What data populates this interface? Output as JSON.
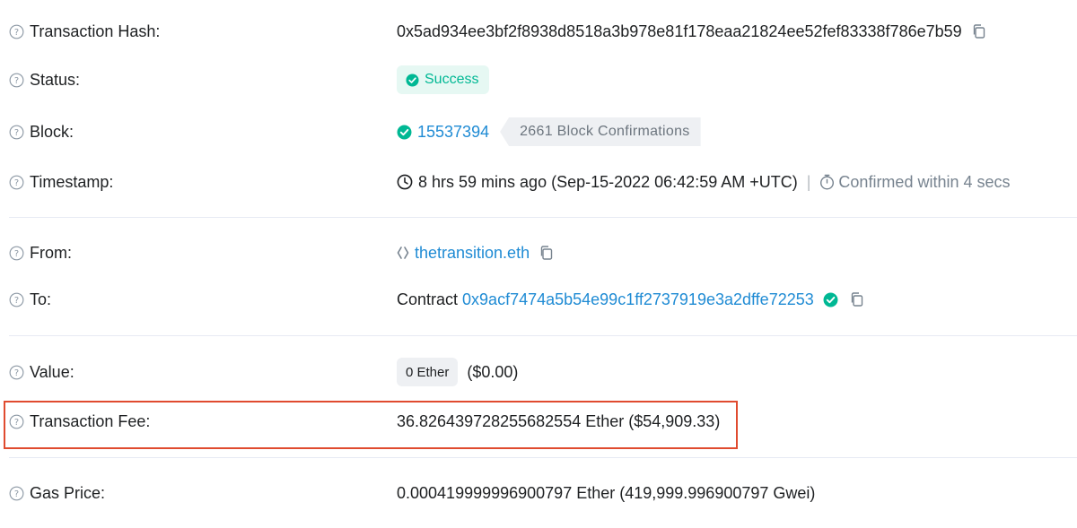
{
  "rows": {
    "tx_hash": {
      "label": "Transaction Hash:",
      "value": "0x5ad934ee3bf2f8938d8518a3b978e81f178eaa21824ee52fef83338f786e7b59"
    },
    "status": {
      "label": "Status:",
      "value": "Success"
    },
    "block": {
      "label": "Block:",
      "number": "15537394",
      "confirmations": "2661 Block Confirmations"
    },
    "timestamp": {
      "label": "Timestamp:",
      "value": "8 hrs 59 mins ago (Sep-15-2022 06:42:59 AM +UTC)",
      "separator": "|",
      "confirmed": "Confirmed within 4 secs"
    },
    "from": {
      "label": "From:",
      "value": "thetransition.eth"
    },
    "to": {
      "label": "To:",
      "prefix": "Contract",
      "address": "0x9acf7474a5b54e99c1ff2737919e3a2dffe72253"
    },
    "value": {
      "label": "Value:",
      "amount": "0 Ether",
      "usd": "($0.00)"
    },
    "fee": {
      "label": "Transaction Fee:",
      "value": "36.826439728255682554 Ether ($54,909.33)"
    },
    "gas_price": {
      "label": "Gas Price:",
      "value": "0.000419999996900797 Ether (419,999.996900797 Gwei)"
    }
  },
  "colors": {
    "link": "#1f8bd4",
    "success": "#00b894",
    "success_bg": "#e6f8f3",
    "highlight": "#e04b2f",
    "text": "#1e2022",
    "muted": "#77838f"
  },
  "icons": [
    "question-circle-icon",
    "copy-icon",
    "check-circle-icon",
    "clock-icon",
    "stopwatch-icon",
    "ens-icon"
  ]
}
